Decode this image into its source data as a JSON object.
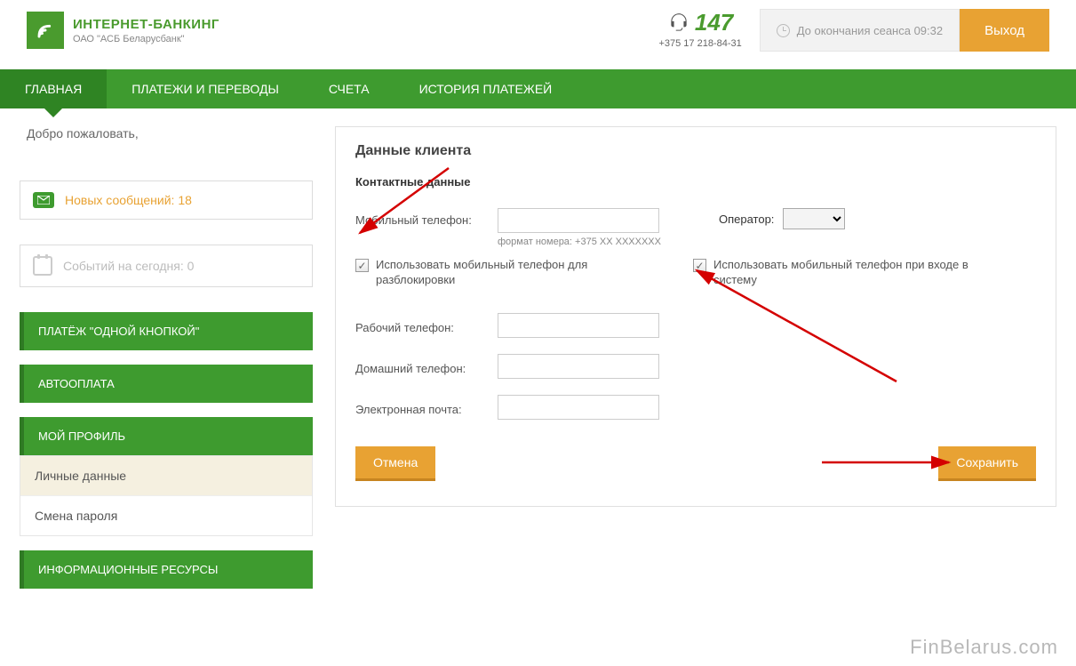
{
  "header": {
    "title": "ИНТЕРНЕТ-БАНКИНГ",
    "subtitle": "ОАО \"АСБ Беларусбанк\"",
    "support_number": "147",
    "support_phone": "+375 17 218-84-31",
    "session_label": "До окончания сеанса 09:32",
    "logout": "Выход"
  },
  "nav": {
    "items": [
      "ГЛАВНАЯ",
      "ПЛАТЕЖИ И ПЕРЕВОДЫ",
      "СЧЕТА",
      "ИСТОРИЯ ПЛАТЕЖЕЙ"
    ],
    "active": 0
  },
  "sidebar": {
    "welcome": "Добро пожаловать,",
    "messages": "Новых сообщений: 18",
    "events": "Событий на сегодня: 0",
    "menu": [
      "ПЛАТЁЖ \"ОДНОЙ КНОПКОЙ\"",
      "АВТООПЛАТА",
      "МОЙ ПРОФИЛЬ",
      "ИНФОРМАЦИОННЫЕ РЕСУРСЫ"
    ],
    "submenu": [
      "Личные данные",
      "Смена пароля"
    ],
    "submenu_active": 0
  },
  "panel": {
    "title": "Данные клиента",
    "subtitle": "Контактные данные",
    "mobile_label": "Мобильный телефон:",
    "format_note": "формат номера: +375 XX XXXXXXX",
    "operator_label": "Оператор:",
    "check1": "Использовать мобильный телефон для разблокировки",
    "check2": "Использовать мобильный телефон при входе в систему",
    "work_label": "Рабочий телефон:",
    "home_label": "Домашний телефон:",
    "email_label": "Электронная почта:",
    "cancel": "Отмена",
    "save": "Сохранить"
  },
  "watermark": "FinBelarus.com"
}
